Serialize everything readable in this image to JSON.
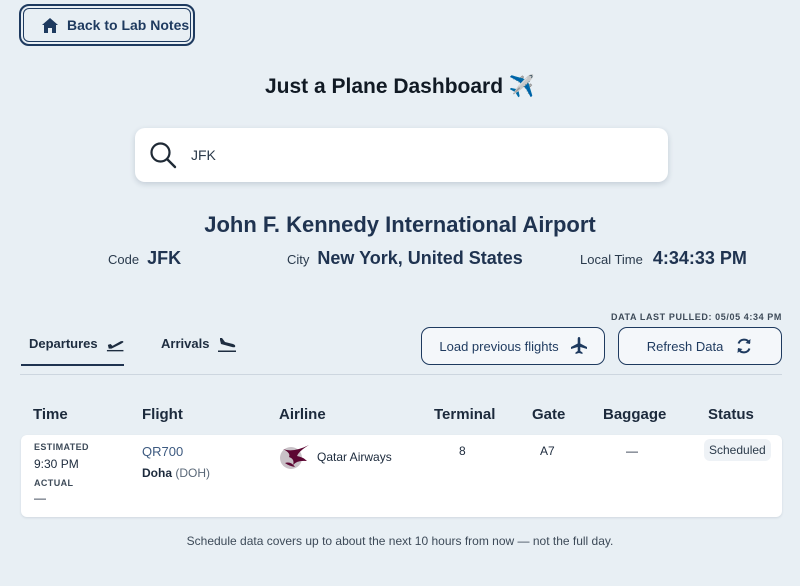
{
  "back_button": {
    "label": "Back to Lab Notes",
    "icon": "home-icon"
  },
  "title": "Just a Plane Dashboard",
  "title_emoji": "✈️",
  "search": {
    "value": "JFK",
    "placeholder": ""
  },
  "airport": {
    "name": "John F. Kennedy International Airport",
    "code_label": "Code",
    "code": "JFK",
    "city_label": "City",
    "city": "New York, United States",
    "time_label": "Local Time",
    "time": "4:34:33 PM"
  },
  "data_pulled": "DATA LAST PULLED: 05/05 4:34 PM",
  "tabs": [
    {
      "label": "Departures",
      "icon": "plane-departure-icon",
      "active": true
    },
    {
      "label": "Arrivals",
      "icon": "plane-arrival-icon",
      "active": false
    }
  ],
  "buttons": {
    "load_previous": "Load previous flights",
    "refresh": "Refresh Data"
  },
  "table": {
    "headers": [
      "Time",
      "Flight",
      "Airline",
      "Terminal",
      "Gate",
      "Baggage",
      "Status"
    ],
    "rows": [
      {
        "estimated_label": "ESTIMATED",
        "estimated": "9:30 PM",
        "actual_label": "ACTUAL",
        "actual": "—",
        "flight": "QR700",
        "destination": "Doha",
        "destination_code": "(DOH)",
        "airline": "Qatar Airways",
        "terminal": "8",
        "gate": "A7",
        "baggage": "—",
        "status": "Scheduled"
      }
    ]
  },
  "footnote": "Schedule data covers up to about the next 10 hours from now — not the full day.",
  "colors": {
    "accent": "#1e3a5f",
    "background": "#e8eff4",
    "qatar_maroon": "#5c0632"
  }
}
